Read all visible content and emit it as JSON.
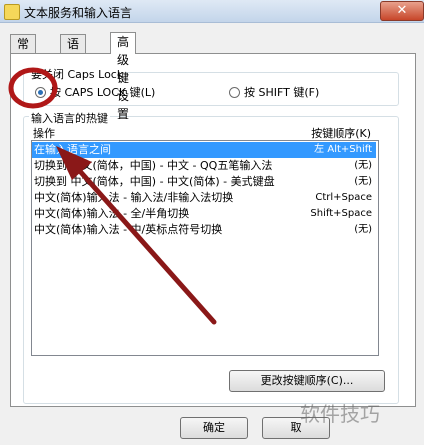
{
  "window": {
    "title": "文本服务和输入语言",
    "close_glyph": "✕"
  },
  "tabs": [
    {
      "label": "常规"
    },
    {
      "label": "语言栏"
    },
    {
      "label": "高级键设置"
    }
  ],
  "caps_group": {
    "label": "要关闭 Caps Lock",
    "options": [
      {
        "label": "按 CAPS LOCK 键(L)",
        "checked": true
      },
      {
        "label": "按 SHIFT 键(F)",
        "checked": false
      }
    ]
  },
  "hotkeys": {
    "group_label": "输入语言的热键",
    "col_action": "操作",
    "col_keys": "按键顺序(K)",
    "rows": [
      {
        "action": "在输入语言之间",
        "keys": "左 Alt+Shift",
        "selected": true
      },
      {
        "action": "切换到 中文(简体，中国) - 中文 - QQ五笔输入法",
        "keys": "(无)"
      },
      {
        "action": "切换到 中文(简体，中国) - 中文(简体) - 美式键盘",
        "keys": "(无)"
      },
      {
        "action": "中文(简体)输入法 - 输入法/非输入法切换",
        "keys": "Ctrl+Space"
      },
      {
        "action": "中文(简体)输入法 - 全/半角切换",
        "keys": "Shift+Space"
      },
      {
        "action": "中文(简体)输入法 - 中/英标点符号切换",
        "keys": "(无)"
      }
    ]
  },
  "buttons": {
    "change_sequence": "更改按键顺序(C)...",
    "ok": "确定",
    "cancel": "取"
  },
  "watermark": "软件技巧",
  "colors": {
    "annotation": "#b01818",
    "selection": "#3399ff"
  }
}
